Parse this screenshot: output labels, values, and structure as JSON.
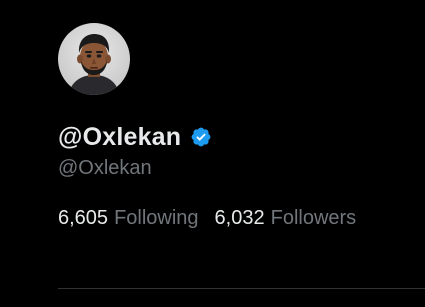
{
  "profile": {
    "avatar_icon": "profile-avatar-illustration",
    "display_name": "@Oxlekan",
    "verified_icon": "verified-badge-icon",
    "verified_color": "#1d9bf0",
    "handle": "@Oxlekan"
  },
  "stats": {
    "following_count": "6,605",
    "following_label": "Following",
    "followers_count": "6,032",
    "followers_label": "Followers"
  },
  "colors": {
    "background": "#000000",
    "primary_text": "#e7e9ea",
    "secondary_text": "#71767b",
    "divider": "#2f3336"
  }
}
